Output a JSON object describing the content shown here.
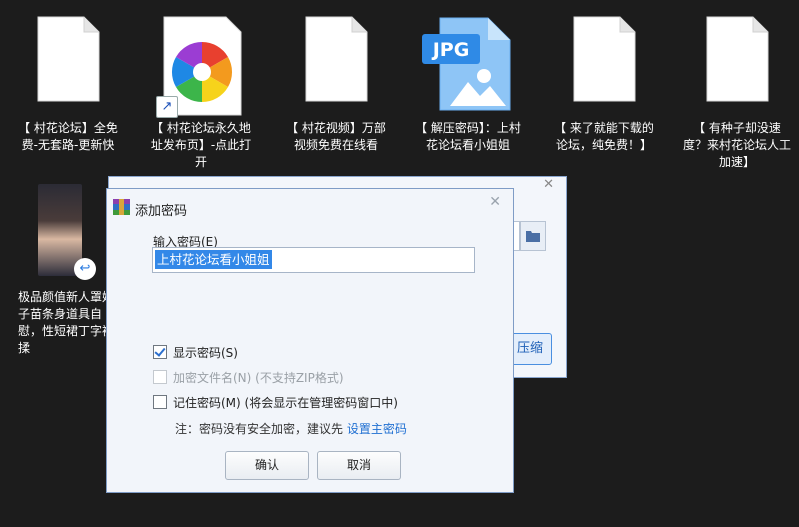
{
  "desktop": {
    "icons": [
      {
        "label": "【 村花论坛】全免费-无套路-更新快"
      },
      {
        "label": "【 村花论坛永久地址发布页】-点此打开"
      },
      {
        "label": "【 村花视频】万部视频免费在线看"
      },
      {
        "label": "【 解压密码】：上村花论坛看小姐姐",
        "badge": "JPG"
      },
      {
        "label": "【 来了就能下载的论坛，纯免费！】"
      },
      {
        "label": "【 有种子却没速度？来村花论坛人工加速】"
      },
      {
        "label": "极品颜值新人罩妹子苗条身道具自慰，性短裙丁字裤揉"
      }
    ]
  },
  "background_window": {
    "compress_label": "压缩"
  },
  "dialog": {
    "title": "添加密码",
    "password_label": "输入密码(E)",
    "password_value": "上村花论坛看小姐姐",
    "show_password_label": "显示密码(S)",
    "encrypt_filenames_label": "加密文件名(N) (不支持ZIP格式)",
    "remember_password_label": "记住密码(M) (将会显示在管理密码窗口中)",
    "note_prefix": "注：密码没有安全加密，建议先 ",
    "note_link": "设置主密码",
    "ok_label": "确认",
    "cancel_label": "取消",
    "checkboxes": {
      "show_password": true,
      "encrypt_filenames": false,
      "remember_password": false
    }
  },
  "colors": {
    "desktop_bg": "#1c1c1c",
    "selection": "#3388e8",
    "link": "#1f6fd2"
  }
}
